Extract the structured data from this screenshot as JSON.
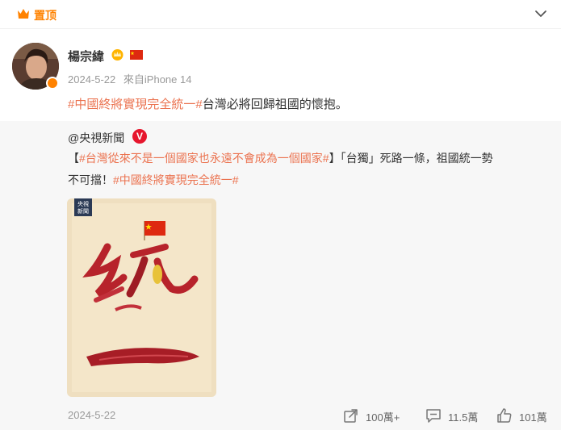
{
  "pinned": {
    "label": "置顶"
  },
  "author": {
    "name": "楊宗緯",
    "date": "2024-5-22",
    "source": "來自iPhone 14"
  },
  "post": {
    "hashtag": "#中國終將實現完全統一#",
    "text": "台灣必將回歸祖國的懷抱。"
  },
  "repost": {
    "author": "@央視新聞",
    "verified_badge": "V",
    "bracket_open": "【",
    "hashtag1": "#台灣從來不是一個國家也永遠不會成為一個國家#",
    "bracket_close": "】",
    "text1": "「台獨」死路一條，祖國統一勢",
    "text2": "不可擋！",
    "hashtag2": "#中國終將實現完全統一#",
    "image": {
      "logo_text": "央視新聞",
      "calligraphy": "統一"
    }
  },
  "footer": {
    "date": "2024-5-22",
    "share_count": "100萬+",
    "comment_count": "11.5萬",
    "like_count": "101萬"
  },
  "colors": {
    "accent": "#ff8200",
    "hashtag": "#eb7350",
    "verified": "#e6162d"
  }
}
